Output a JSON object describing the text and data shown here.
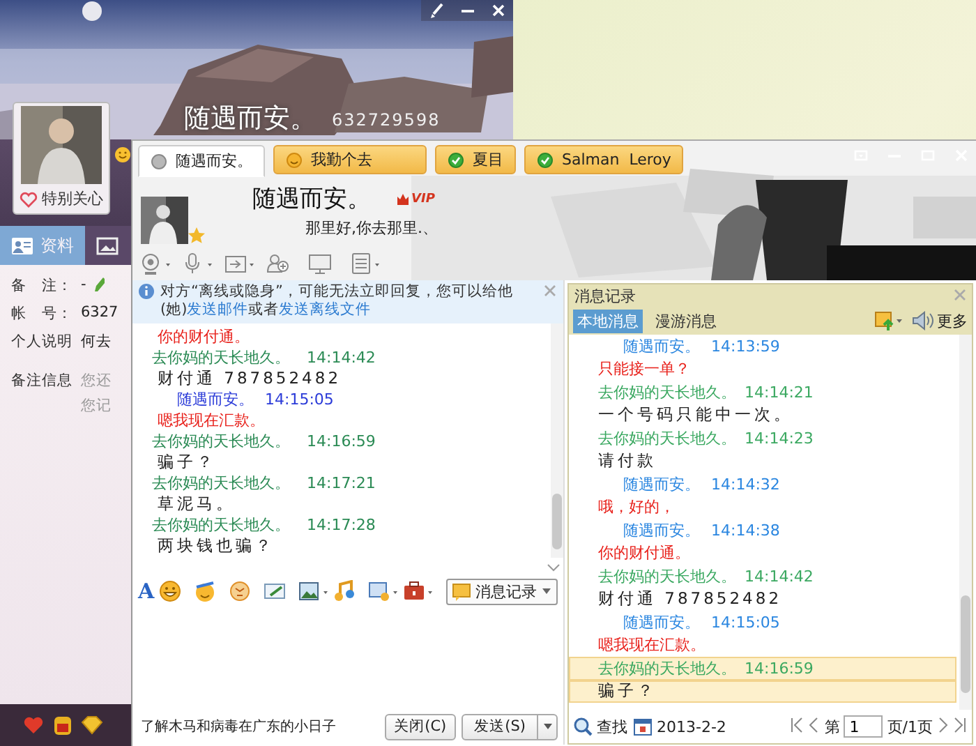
{
  "profile_window": {
    "name": "随遇而安。",
    "account": "632729598",
    "avatar_caption": "特别关心",
    "tabs": [
      {
        "label": "资料",
        "selected": true
      },
      {
        "selected": false
      }
    ],
    "fields": [
      {
        "label": "备　注：",
        "lines": [
          "-"
        ],
        "editable": true,
        "muted": false
      },
      {
        "label": "帐　号：",
        "lines": [
          "6327"
        ],
        "editable": false,
        "muted": false
      },
      {
        "label": "个人说明",
        "lines": [
          "何去"
        ],
        "editable": false,
        "muted": false
      },
      {
        "label": "备注信息",
        "lines": [
          "您还",
          "您记"
        ],
        "editable": false,
        "muted": true
      }
    ]
  },
  "chat_window": {
    "tabs": [
      {
        "label": "随遇而安。",
        "kind": "offline",
        "selected": true
      },
      {
        "label": "我勤个去",
        "kind": "away",
        "selected": false
      },
      {
        "label": "夏目",
        "kind": "online",
        "selected": false
      },
      {
        "label": "Salman  Leroy",
        "kind": "online",
        "selected": false
      }
    ],
    "contact": {
      "name": "随遇而安。",
      "badge": "VIP",
      "signature": "那里好,你去那里.、"
    },
    "notice": {
      "text": "对方“离线或隐身”，可能无法立即回复，您可以给他(她)",
      "link": "发送邮件",
      "middle": "或者",
      "link_2": "发送离线文件"
    },
    "messages": [
      {
        "kind": "text",
        "mine": true,
        "text": "你的财付通。"
      },
      {
        "kind": "header",
        "mine": false,
        "name": "去你妈的天长地久。",
        "time": "14:14:42"
      },
      {
        "kind": "text",
        "mine": false,
        "text": "财付通 787852482"
      },
      {
        "kind": "header",
        "mine": true,
        "name": "随遇而安。",
        "time": "14:15:05"
      },
      {
        "kind": "text",
        "mine": true,
        "text": "嗯我现在汇款。"
      },
      {
        "kind": "header",
        "mine": false,
        "name": "去你妈的天长地久。",
        "time": "14:16:59"
      },
      {
        "kind": "text",
        "mine": false,
        "text": "骗子？"
      },
      {
        "kind": "header",
        "mine": false,
        "name": "去你妈的天长地久。",
        "time": "14:17:21"
      },
      {
        "kind": "text",
        "mine": false,
        "text": "草泥马。"
      },
      {
        "kind": "header",
        "mine": false,
        "name": "去你妈的天长地久。",
        "time": "14:17:28"
      },
      {
        "kind": "text",
        "mine": false,
        "text": "两块钱也骗？"
      }
    ],
    "toolbar": {
      "font_label": "A",
      "history_button": "消息记录"
    },
    "ad": "了解木马和病毒在广东的小日子",
    "buttons": [
      "关闭(C)",
      "发送(S)"
    ]
  },
  "history": {
    "title": "消息记录",
    "tabs": [
      {
        "label": "本地消息",
        "selected": true
      },
      {
        "label": "漫游消息",
        "selected": false
      }
    ],
    "more": "更多",
    "messages": [
      {
        "kind": "header",
        "mine": true,
        "name": "随遇而安。",
        "time": "14:13:59",
        "selected": false
      },
      {
        "kind": "text",
        "mine": true,
        "text": "只能接一单？",
        "selected": false
      },
      {
        "kind": "header",
        "mine": false,
        "name": "去你妈的天长地久。",
        "time": "14:14:21",
        "selected": false
      },
      {
        "kind": "text",
        "mine": false,
        "text": "一个号码只能中一次。",
        "selected": false
      },
      {
        "kind": "header",
        "mine": false,
        "name": "去你妈的天长地久。",
        "time": "14:14:23",
        "selected": false
      },
      {
        "kind": "text",
        "mine": false,
        "text": "请付款",
        "selected": false
      },
      {
        "kind": "header",
        "mine": true,
        "name": "随遇而安。",
        "time": "14:14:32",
        "selected": false
      },
      {
        "kind": "text",
        "mine": true,
        "text": "哦，好的，",
        "selected": false
      },
      {
        "kind": "header",
        "mine": true,
        "name": "随遇而安。",
        "time": "14:14:38",
        "selected": false
      },
      {
        "kind": "text",
        "mine": true,
        "text": "你的财付通。",
        "selected": false
      },
      {
        "kind": "header",
        "mine": false,
        "name": "去你妈的天长地久。",
        "time": "14:14:42",
        "selected": false
      },
      {
        "kind": "text",
        "mine": false,
        "text": "财付通 787852482",
        "selected": false
      },
      {
        "kind": "header",
        "mine": true,
        "name": "随遇而安。",
        "time": "14:15:05",
        "selected": false
      },
      {
        "kind": "text",
        "mine": true,
        "text": "嗯我现在汇款。",
        "selected": false
      },
      {
        "kind": "header",
        "mine": false,
        "name": "去你妈的天长地久。",
        "time": "14:16:59",
        "selected": true
      },
      {
        "kind": "text",
        "mine": false,
        "text": "骗子？",
        "selected": true
      }
    ],
    "search": "查找",
    "date": "2013-2-2",
    "page_prefix": "第",
    "page": "1",
    "page_suffix": "页/1页"
  }
}
